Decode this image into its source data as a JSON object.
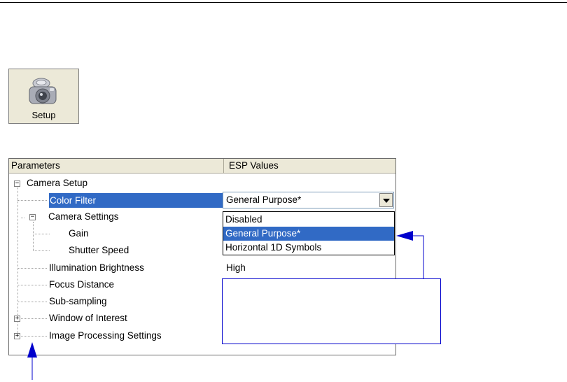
{
  "setup_button": {
    "label": "Setup",
    "icon": "camera-icon"
  },
  "tree": {
    "headers": {
      "parameters": "Parameters",
      "values": "ESP Values"
    },
    "camera_setup": "Camera Setup",
    "color_filter": {
      "label": "Color Filter",
      "value": "General Purpose*"
    },
    "camera_settings": "Camera Settings",
    "gain": "Gain",
    "shutter_speed": "Shutter Speed",
    "illumination": {
      "label": "Illumination Brightness",
      "value": "High"
    },
    "focus_distance": "Focus Distance",
    "sub_sampling": "Sub-sampling",
    "window_of_interest": "Window of Interest",
    "image_processing": "Image Processing Settings",
    "expander_collapse": "−",
    "expander_expand": "+"
  },
  "dropdown": {
    "options": [
      "Disabled",
      "General Purpose*",
      "Horizontal 1D Symbols"
    ],
    "selected_index": 1
  },
  "colors": {
    "selection": "#316ac5",
    "arrow": "#0000cc",
    "callout_border": "#0000cc"
  }
}
